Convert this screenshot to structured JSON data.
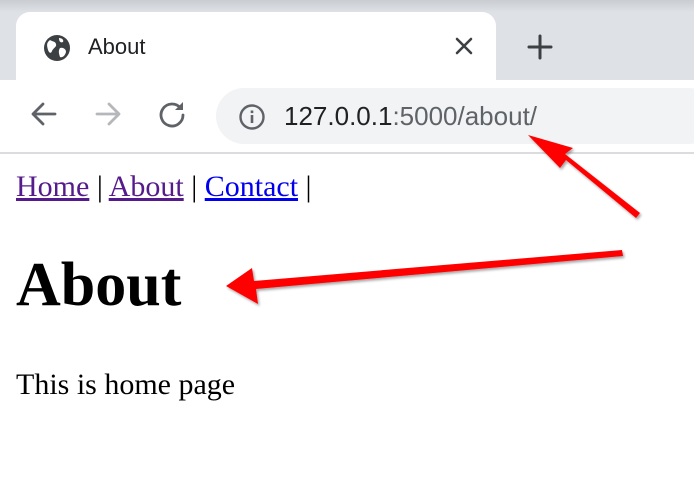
{
  "browser": {
    "tab": {
      "title": "About",
      "favicon": "globe-icon",
      "close_icon": "close-icon"
    },
    "new_tab_icon": "plus-icon",
    "toolbar": {
      "back_icon": "arrow-left-icon",
      "forward_icon": "arrow-right-icon",
      "reload_icon": "reload-icon",
      "info_icon": "info-icon",
      "url_host": "127.0.0.1",
      "url_path": ":5000/about/"
    }
  },
  "page": {
    "nav": {
      "links": [
        "Home",
        "About",
        "Contact"
      ],
      "separator": "|"
    },
    "heading": "About",
    "paragraph": "This is home page"
  },
  "annotations": {
    "arrow_color": "#ff0000",
    "arrows": [
      "arrow-to-url",
      "arrow-to-heading"
    ]
  },
  "colors": {
    "tabstrip": "#dee1e6",
    "omnibox": "#f1f3f4",
    "link_visited": "#551a8b",
    "link_unvisited": "#0000ee"
  }
}
